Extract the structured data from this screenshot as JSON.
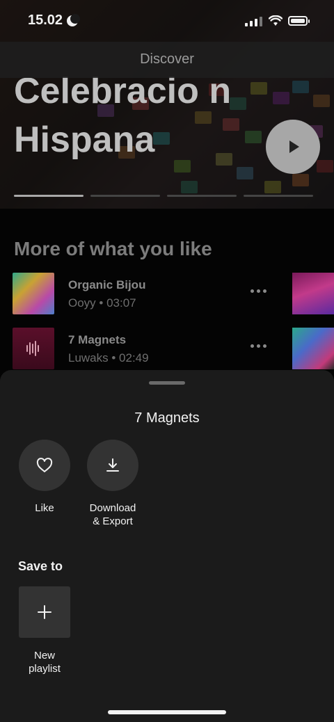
{
  "status_bar": {
    "time": "15.02"
  },
  "header": {
    "title": "Discover"
  },
  "hero": {
    "title": "Celebracio n Hispana"
  },
  "section": {
    "title": "More of what you like"
  },
  "tracks": [
    {
      "title": "Organic Bijou",
      "subtitle": "Ooyy • 03:07"
    },
    {
      "title": "7 Magnets",
      "subtitle": "Luwaks • 02:49"
    }
  ],
  "sheet": {
    "title": "7 Magnets",
    "like_label": "Like",
    "download_label_line1": "Download",
    "download_label_line2": "& Export",
    "save_to_label": "Save to",
    "new_playlist_line1": "New",
    "new_playlist_line2": "playlist"
  },
  "icons": {
    "like": "heart-icon",
    "download": "download-icon",
    "add": "plus-icon",
    "play": "play-icon",
    "more": "more-dots-icon"
  },
  "colors": {
    "sheet_bg": "#1b1b1b",
    "button_bg": "#333333",
    "play_bg": "#a7a7a7"
  }
}
